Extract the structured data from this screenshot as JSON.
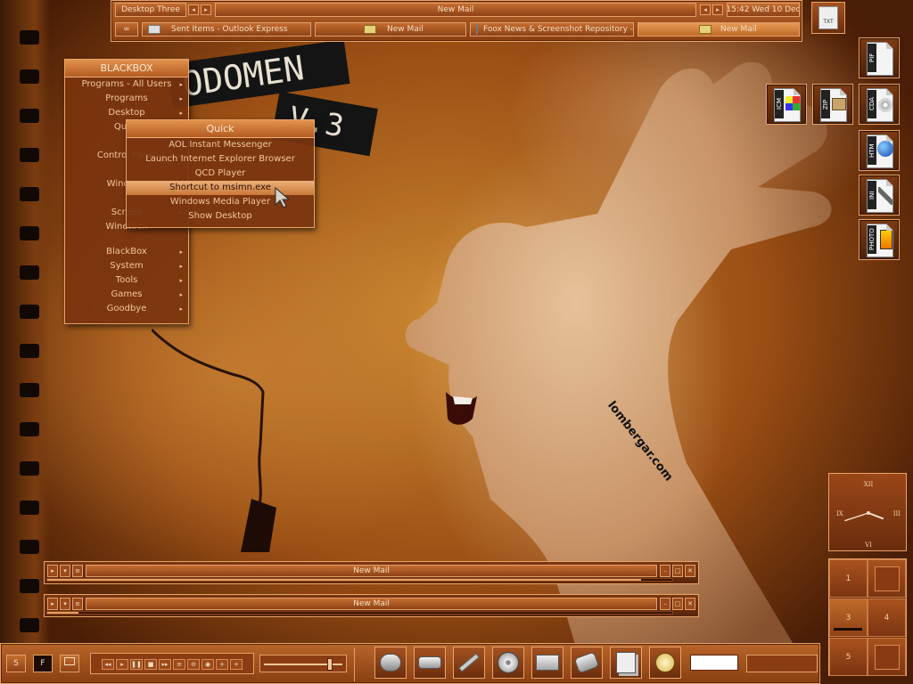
{
  "wallpaper": {
    "watermark": "lombergar.com",
    "title_line1": "ODOMEN",
    "title_line2": "V.3"
  },
  "top_toolbar": {
    "workspace_label": "Desktop Three",
    "window_label": "New Mail",
    "clock_text": "15:42 Wed 10 Dec",
    "tasks": [
      {
        "label": "Sent Items - Outlook Express",
        "icon": "mail-icon"
      },
      {
        "label": "New Mail",
        "icon": "folder-icon"
      },
      {
        "label": "Foox News & Screenshot Repository - ...",
        "icon": "web-icon"
      },
      {
        "label": "New Mail",
        "icon": "folder-icon",
        "active": true
      }
    ],
    "tray_icon": "txt-file-icon"
  },
  "blackbox_menu": {
    "title": "BLACKBOX",
    "items": [
      {
        "label": "Programs - All Users",
        "sub": true
      },
      {
        "label": "Programs",
        "sub": true
      },
      {
        "label": "Desktop",
        "sub": true
      },
      {
        "label": "Quick",
        "sub": true
      },
      {
        "label": "",
        "sub": false
      },
      {
        "label": "Control Panel",
        "sub": true
      },
      {
        "label": "",
        "sub": false
      },
      {
        "label": "Windows",
        "sub": true
      },
      {
        "label": "",
        "sub": false
      },
      {
        "label": "Screen",
        "sub": true
      },
      {
        "label": "Winetbox",
        "sub": false
      },
      {
        "label": "",
        "sub": false
      },
      {
        "label": "BlackBox",
        "sub": true
      },
      {
        "label": "System",
        "sub": true
      },
      {
        "label": "Tools",
        "sub": true
      },
      {
        "label": "Games",
        "sub": true
      },
      {
        "label": "Goodbye",
        "sub": true
      }
    ]
  },
  "quick_menu": {
    "title": "Quick",
    "items": [
      {
        "label": "AOL Instant Messenger",
        "highlighted": false
      },
      {
        "label": "Launch Internet Explorer Browser",
        "highlighted": false
      },
      {
        "label": "QCD Player",
        "highlighted": false
      },
      {
        "label": "Shortcut to msimn.exe",
        "highlighted": true
      },
      {
        "label": "Windows Media Player",
        "highlighted": false
      },
      {
        "label": "Show Desktop",
        "highlighted": false
      }
    ]
  },
  "desktop_icons": [
    {
      "tag": "PIF",
      "icon": "pif-file-icon"
    },
    {
      "tag": "ICM",
      "icon": "icm-file-icon"
    },
    {
      "tag": "ZIP",
      "icon": "zip-file-icon"
    },
    {
      "tag": "CDA",
      "icon": "cda-file-icon"
    },
    {
      "tag": "HTM",
      "icon": "htm-file-icon"
    },
    {
      "tag": "INI",
      "icon": "ini-file-icon"
    },
    {
      "tag": "PHOTO",
      "icon": "photo-file-icon"
    }
  ],
  "clock": {
    "numerals": {
      "top": "XII",
      "left": "IX",
      "right": "III",
      "bottom": "VI"
    },
    "hour": 3,
    "minute": 42
  },
  "pager": {
    "cells": [
      "1",
      "",
      "3",
      "4",
      "5",
      ""
    ],
    "current": "3"
  },
  "windows": [
    {
      "title": "New Mail",
      "progress": 0.95
    },
    {
      "title": "New Mail",
      "progress": 0.05
    }
  ],
  "taskbar": {
    "left_button": "S",
    "second_button": "F",
    "media_controls": [
      "◂◂",
      "▸",
      "❚❚",
      "■",
      "▸▸",
      "≡",
      "⊖",
      "◉",
      "+",
      "+"
    ],
    "volume": 0.85,
    "quicklaunch": [
      "pipe-icon",
      "drive-icon",
      "wrench-icon",
      "film-reel-icon",
      "folder-icon",
      "cd-drive-icon",
      "documents-icon",
      "power-icon"
    ],
    "input_value": ""
  },
  "colors": {
    "accent": "#e7a468",
    "bar": "#b8652a",
    "dark": "#5a250b",
    "text": "#f3d3a8",
    "highlight": "#ebb17a"
  }
}
